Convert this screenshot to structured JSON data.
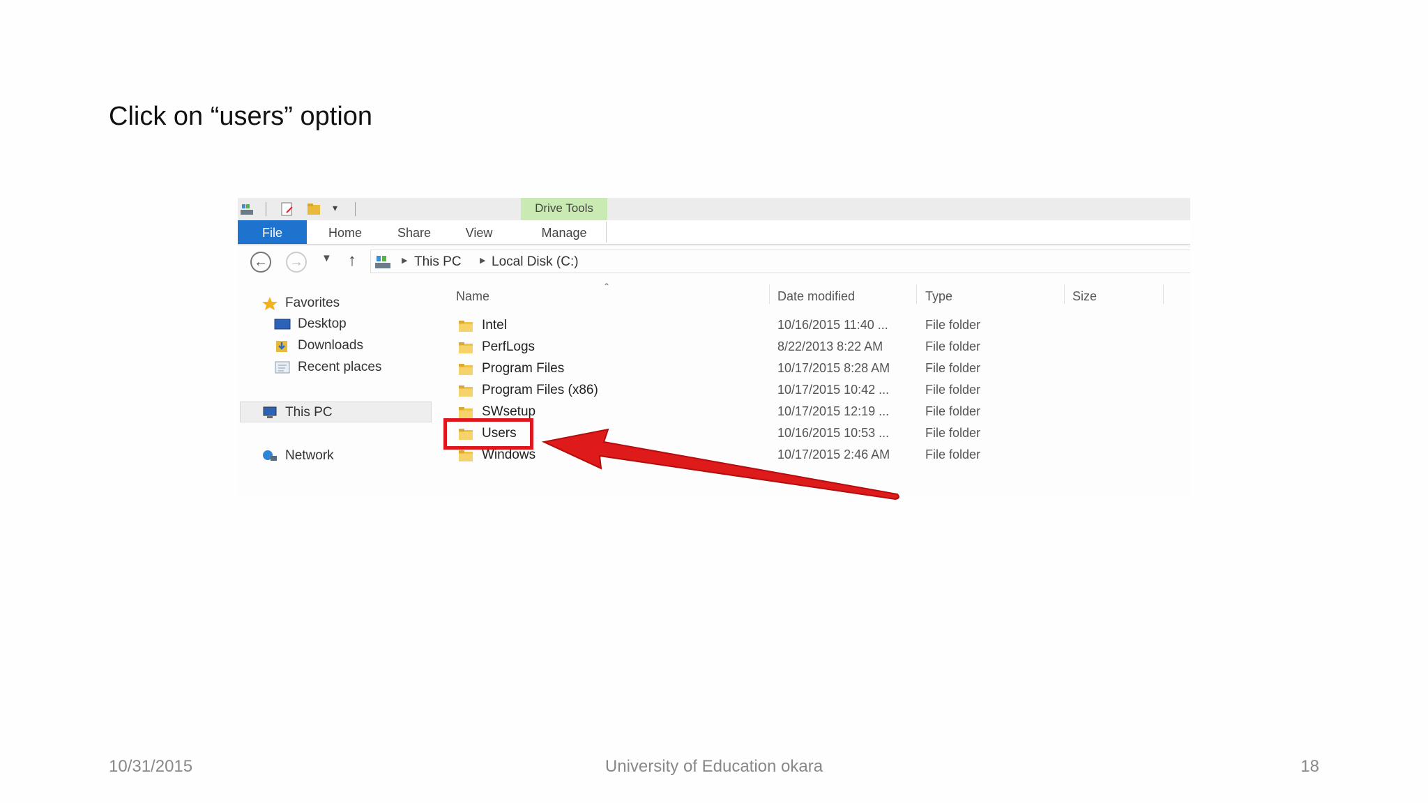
{
  "slide": {
    "title": "Click on “users” option",
    "footer_date": "10/31/2015",
    "footer_center": "University of Education okara",
    "page_number": "18"
  },
  "ribbon": {
    "context_tab": "Drive Tools",
    "tabs": [
      "File",
      "Home",
      "Share",
      "View",
      "Manage"
    ]
  },
  "address": {
    "crumbs": [
      "This PC",
      "Local Disk (C:)"
    ]
  },
  "nav_pane": {
    "favorites": "Favorites",
    "favorites_items": [
      "Desktop",
      "Downloads",
      "Recent places"
    ],
    "this_pc": "This PC",
    "network": "Network"
  },
  "columns": {
    "name": "Name",
    "date": "Date modified",
    "type": "Type",
    "size": "Size"
  },
  "files": [
    {
      "name": "Intel",
      "date": "10/16/2015 11:40 ...",
      "type": "File folder"
    },
    {
      "name": "PerfLogs",
      "date": "8/22/2013 8:22 AM",
      "type": "File folder"
    },
    {
      "name": "Program Files",
      "date": "10/17/2015 8:28 AM",
      "type": "File folder"
    },
    {
      "name": "Program Files (x86)",
      "date": "10/17/2015 10:42 ...",
      "type": "File folder"
    },
    {
      "name": "SWsetup",
      "date": "10/17/2015 12:19 ...",
      "type": "File folder"
    },
    {
      "name": "Users",
      "date": "10/16/2015 10:53 ...",
      "type": "File folder"
    },
    {
      "name": "Windows",
      "date": "10/17/2015 2:46 AM",
      "type": "File folder"
    }
  ],
  "icons": {
    "back": "back-arrow-icon",
    "forward": "forward-arrow-icon",
    "up": "up-arrow-icon",
    "drive": "drive-icon",
    "folder": "folder-icon",
    "star": "star-icon",
    "desktop": "desktop-icon",
    "downloads": "downloads-icon",
    "recent": "recent-places-icon",
    "computer": "computer-icon",
    "network": "network-icon"
  },
  "colors": {
    "file_tab": "#1e73cf",
    "drive_tools": "#c9eab2",
    "annotation": "#e0161f"
  }
}
